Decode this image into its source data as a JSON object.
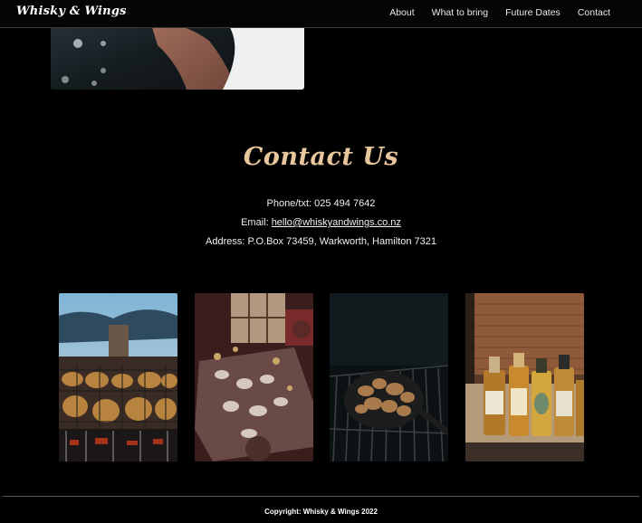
{
  "nav": {
    "brand": "Whisky & Wings",
    "links": [
      "About",
      "What to bring",
      "Future Dates",
      "Contact"
    ]
  },
  "contact": {
    "title": "Contact Us",
    "phone": "Phone/txt: 025 494 7642",
    "email_label": "Email: ",
    "email": "hello@whiskyandwings.co.nz",
    "address": "Address: P.O.Box 73459, Warkworth, Hamilton 7321"
  },
  "footer": {
    "copyright": "Copyright: Whisky & Wings 2022"
  },
  "colors": {
    "accent": "#e9c79c",
    "background": "#000000",
    "text": "#f0f0f0"
  }
}
